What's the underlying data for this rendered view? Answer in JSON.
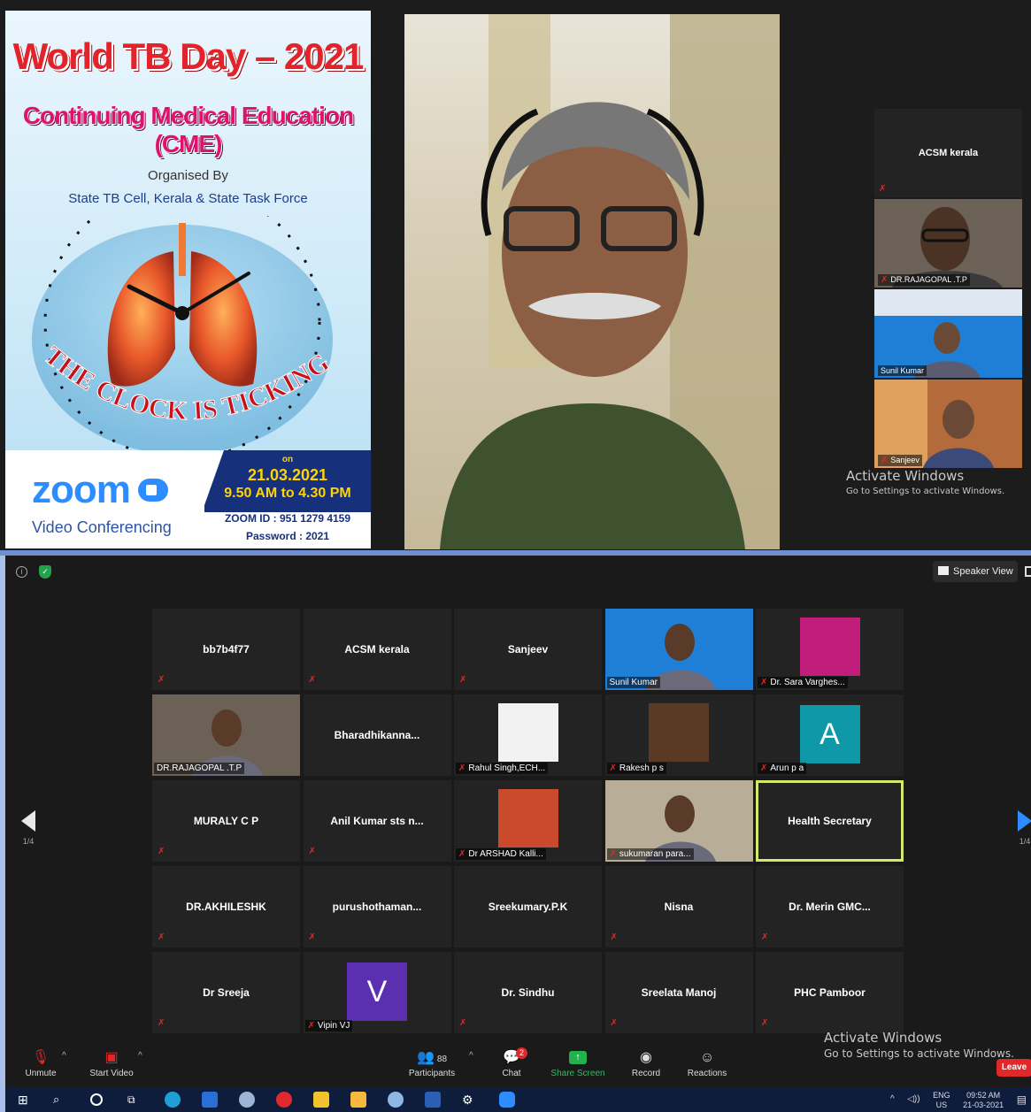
{
  "poster": {
    "title": "World TB Day – 2021",
    "subtitle": "Continuing Medical Education (CME)",
    "organised_by": "Organised By",
    "organisers": "State TB Cell, Kerala & State Task Force",
    "tagline": "THE CLOCK IS TICKING",
    "zoom_logo": "zoom",
    "zoom_subtitle": "Video Conferencing",
    "on_label": "on",
    "date": "21.03.2021",
    "time": "9.50 AM to 4.30 PM",
    "zoom_id": "ZOOM ID : 951 1279 4159",
    "password": "Password : 2021"
  },
  "speaker_strip": [
    {
      "name": "ACSM kerala",
      "muted": true,
      "video": false
    },
    {
      "name": "DR.RAJAGOPAL .T.P",
      "muted": true,
      "video": true
    },
    {
      "name": "Sunil Kumar",
      "muted": false,
      "video": true
    },
    {
      "name": "Sanjeev",
      "muted": true,
      "video": true
    }
  ],
  "activate_windows": {
    "title": "Activate Windows",
    "subtitle": "Go to Settings to activate Windows."
  },
  "gallery": {
    "view_button": "Speaker View",
    "page_prev": "1/4",
    "page_next": "1/4",
    "tiles": [
      {
        "name": "bb7b4f77",
        "type": "name",
        "muted": true
      },
      {
        "name": "ACSM kerala",
        "type": "name",
        "muted": true
      },
      {
        "name": "Sanjeev",
        "type": "name",
        "muted": true
      },
      {
        "name": "Sunil Kumar",
        "type": "video",
        "muted": false
      },
      {
        "name": "Dr. Sara Varghes...",
        "type": "picture",
        "muted": true
      },
      {
        "name": "DR.RAJAGOPAL .T.P",
        "type": "video",
        "muted": false
      },
      {
        "name": "Bharadhikanna...",
        "type": "name",
        "muted": false
      },
      {
        "name": "Rahul Singh,ECH...",
        "type": "picture",
        "muted": true
      },
      {
        "name": "Rakesh p s",
        "type": "picture",
        "muted": true
      },
      {
        "name": "Arun p a",
        "type": "letter",
        "letter": "A",
        "letter_color": "#0e98a8",
        "muted": true
      },
      {
        "name": "MURALY C P",
        "type": "name",
        "muted": true
      },
      {
        "name": "Anil Kumar sts n...",
        "type": "name",
        "muted": true
      },
      {
        "name": "Dr ARSHAD Kalli...",
        "type": "picture",
        "muted": true
      },
      {
        "name": "sukumaran para...",
        "type": "video",
        "muted": true
      },
      {
        "name": "Health Secretary",
        "type": "name",
        "muted": false,
        "active": true
      },
      {
        "name": "DR.AKHILESHK",
        "type": "name",
        "muted": true
      },
      {
        "name": "purushothaman...",
        "type": "name",
        "muted": true
      },
      {
        "name": "Sreekumary.P.K",
        "type": "name",
        "muted": false
      },
      {
        "name": "Nisna",
        "type": "name",
        "muted": true
      },
      {
        "name": "Dr. Merin GMC...",
        "type": "name",
        "muted": true
      },
      {
        "name": "Dr Sreeja",
        "type": "name",
        "muted": true
      },
      {
        "name": "Vipin VJ",
        "type": "letter",
        "letter": "V",
        "letter_color": "#5b2fb0",
        "muted": true
      },
      {
        "name": "Dr. Sindhu",
        "type": "name",
        "muted": true
      },
      {
        "name": "Sreelata Manoj",
        "type": "name",
        "muted": true
      },
      {
        "name": "PHC Pamboor",
        "type": "name",
        "muted": true
      }
    ]
  },
  "toolbar": {
    "unmute": "Unmute",
    "start_video": "Start Video",
    "participants": "Participants",
    "participants_count": "88",
    "chat": "Chat",
    "chat_badge": "2",
    "share_screen": "Share Screen",
    "record": "Record",
    "reactions": "Reactions",
    "leave": "Leave"
  },
  "taskbar": {
    "lang_top": "ENG",
    "lang_bottom": "US",
    "time": "09:52 AM",
    "date": "21-03-2021"
  }
}
